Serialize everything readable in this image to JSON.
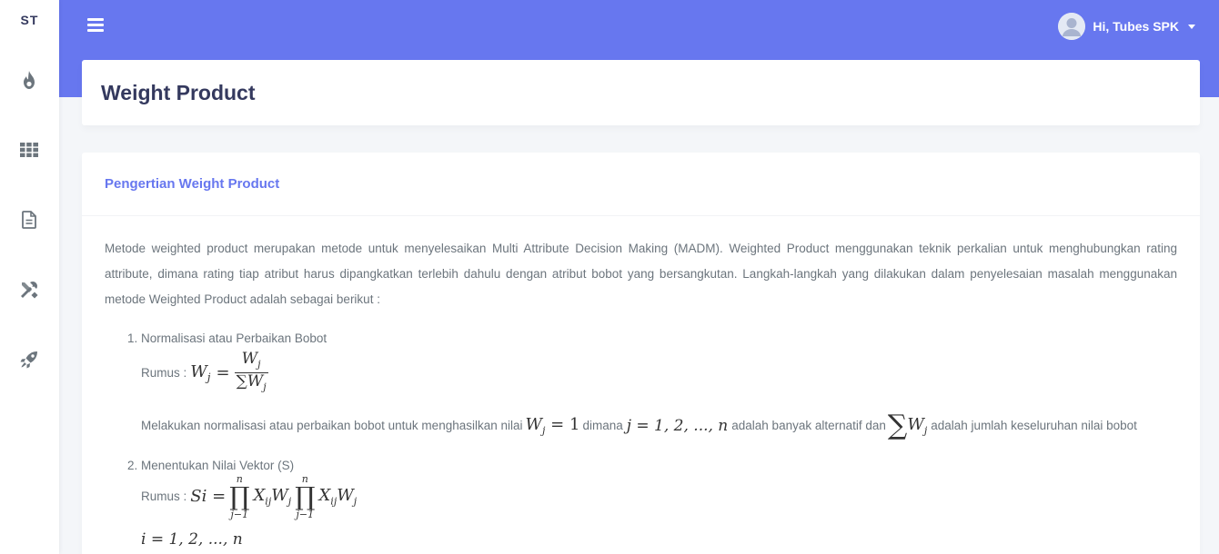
{
  "brand": "ST",
  "sidebar": {
    "icons": [
      "fire-icon",
      "th-grid-icon",
      "file-alt-icon",
      "tools-icon",
      "rocket-icon"
    ]
  },
  "header": {
    "user_greeting": "Hi, Tubes SPK"
  },
  "page": {
    "title": "Weight Product"
  },
  "card": {
    "heading": "Pengertian Weight Product",
    "intro": "Metode weighted product merupakan metode untuk menyelesaikan Multi Attribute Decision Making (MADM). Weighted Product menggunakan teknik perkalian untuk menghubungkan rating attribute, dimana rating tiap atribut harus dipangkatkan terlebih dahulu dengan atribut bobot yang bersangkutan. Langkah-langkah yang dilakukan dalam penyelesaian masalah menggunakan metode Weighted Product adalah sebagai berikut :",
    "steps": [
      {
        "number": "1.",
        "title": "Normalisasi atau Perbaikan Bobot",
        "rumus_label": "Rumus :",
        "formula_lhs": "W",
        "formula_lhs_sub": "j",
        "formula_eq": "=",
        "frac_num": "W",
        "frac_num_sub": "j",
        "frac_den_sigma": "∑",
        "frac_den": "W",
        "frac_den_sub": "j",
        "explain_1": "Melakukan normalisasi atau perbaikan bobot untuk menghasilkan nilai",
        "explain_math_1": "W",
        "explain_math_1_sub": "j",
        "explain_math_1_rest": " = 1",
        "explain_2": "dimana",
        "explain_math_2": "j = 1, 2, ..., n",
        "explain_3": "adalah banyak alternatif dan",
        "explain_sigma": "∑",
        "explain_math_3": "W",
        "explain_math_3_sub": "j",
        "explain_4": "adalah jumlah keseluruhan nilai bobot"
      },
      {
        "number": "2.",
        "title": "Menentukan Nilai Vektor (S)",
        "rumus_label": "Rumus :",
        "formula_lhs": "Si =",
        "prod_upper": "n",
        "prod_symbol": "∏",
        "prod_lower": "j−1",
        "term": "X",
        "term_sub": "ij",
        "term_w": "W",
        "term_w_sub": "j",
        "index_line": "i = 1, 2, ..., n"
      }
    ]
  }
}
